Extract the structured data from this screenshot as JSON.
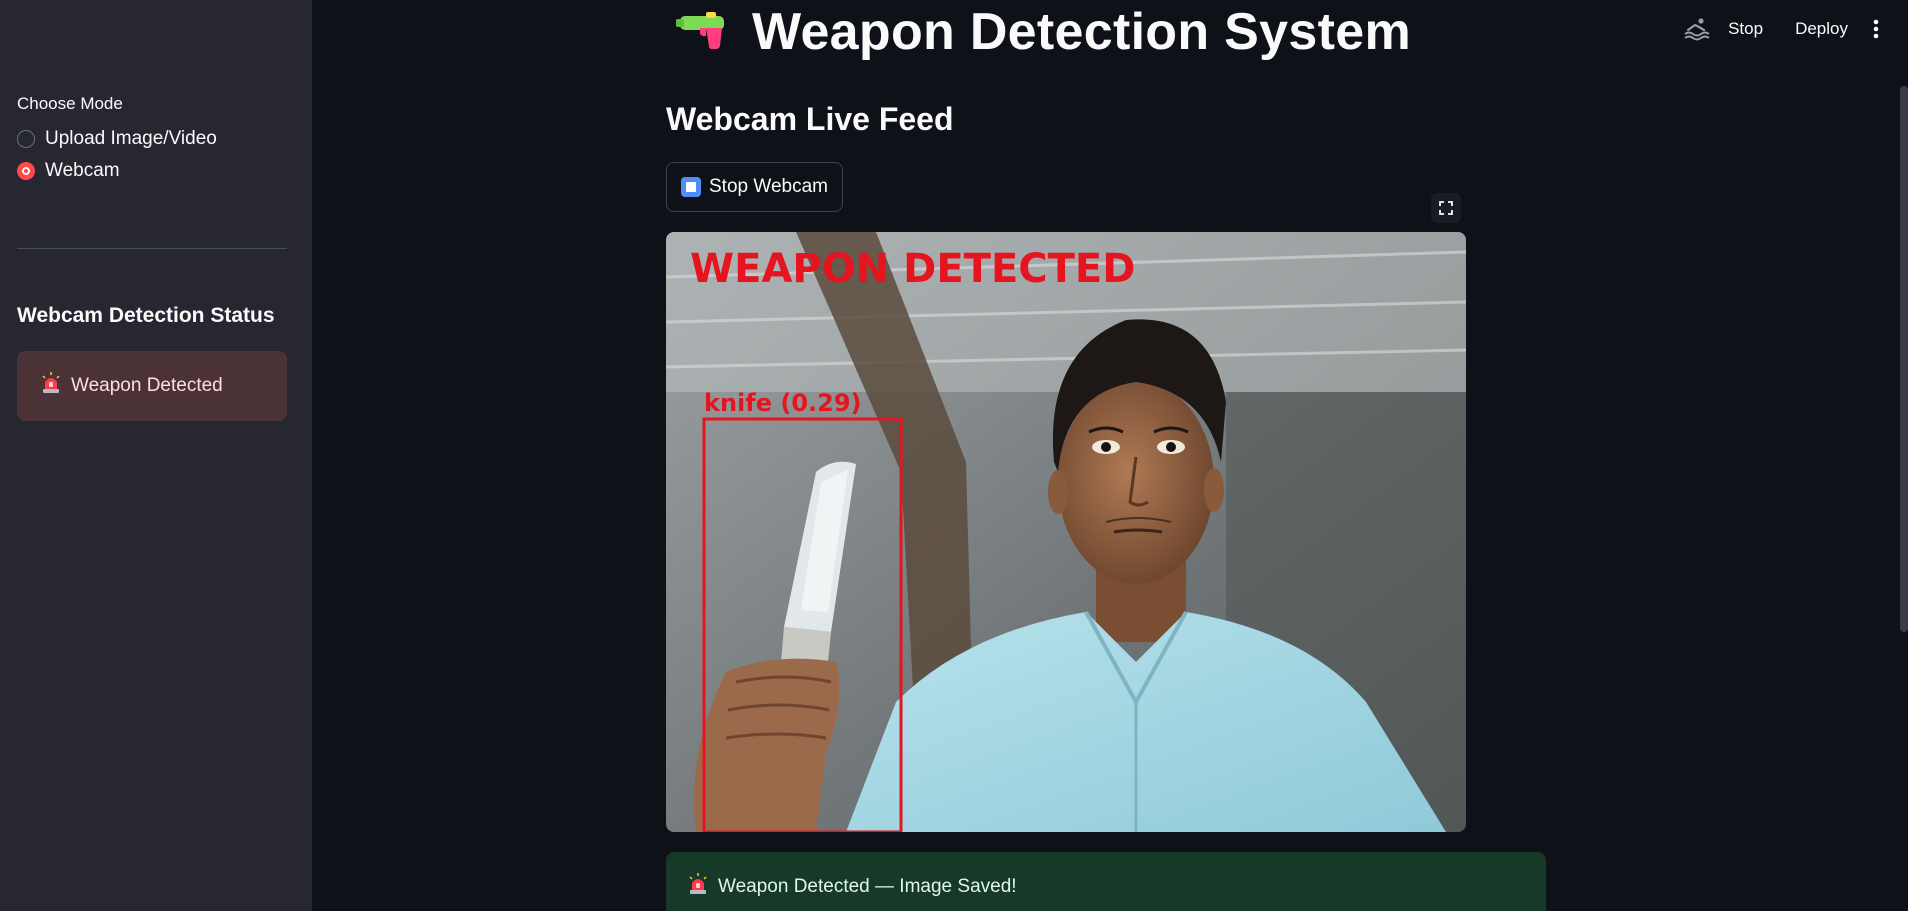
{
  "sidebar": {
    "mode_label": "Choose Mode",
    "options": [
      {
        "label": "Upload Image/Video",
        "selected": false
      },
      {
        "label": "Webcam",
        "selected": true
      }
    ],
    "status_heading": "Webcam Detection Status",
    "status_alert": "Weapon Detected",
    "status_alert_icon": "siren-icon"
  },
  "toolbar": {
    "running_icon": "swimmer-icon",
    "stop_label": "Stop",
    "deploy_label": "Deploy",
    "menu_icon": "kebab-menu-icon"
  },
  "main": {
    "title": "Weapon Detection System",
    "title_icon": "water-pistol-icon",
    "subheading": "Webcam Live Feed",
    "stop_button_label": "Stop Webcam",
    "feed": {
      "banner": "WEAPON DETECTED",
      "detection_label": "knife (0.29)"
    },
    "success_message": "Weapon Detected — Image Saved!"
  },
  "colors": {
    "background": "#0e1117",
    "sidebar": "#262730",
    "accent_red": "#ff4b4b",
    "error_bg": "#4b3237",
    "success_bg": "#173928",
    "detection_red": "#e6141e"
  }
}
